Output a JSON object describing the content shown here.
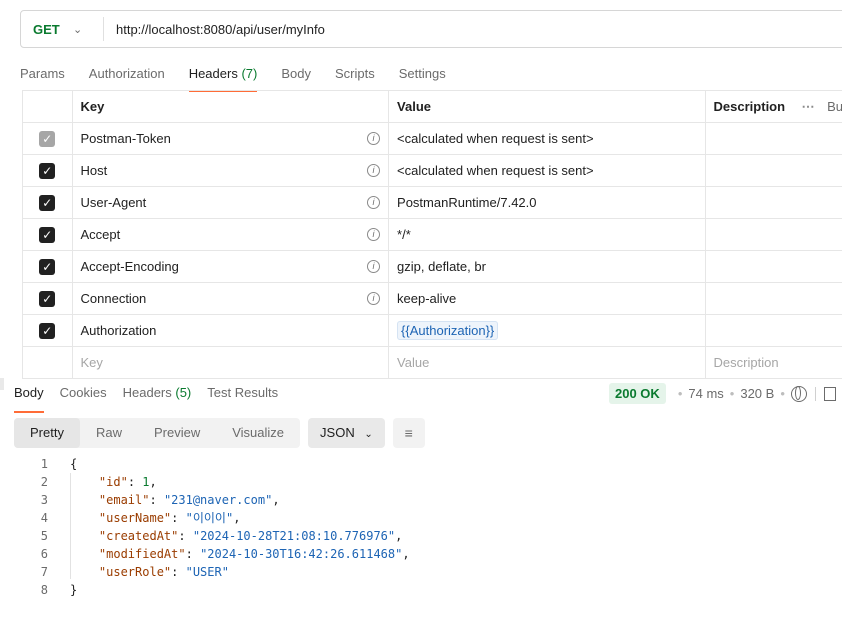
{
  "request": {
    "method": "GET",
    "url": "http://localhost:8080/api/user/myInfo"
  },
  "request_tabs": [
    {
      "label": "Params",
      "count": ""
    },
    {
      "label": "Authorization",
      "count": ""
    },
    {
      "label": "Headers",
      "count": "(7)"
    },
    {
      "label": "Body",
      "count": ""
    },
    {
      "label": "Scripts",
      "count": ""
    },
    {
      "label": "Settings",
      "count": ""
    }
  ],
  "headers_table": {
    "columns": {
      "key": "Key",
      "value": "Value",
      "description": "Description",
      "bulk": "Bu"
    },
    "rows": [
      {
        "key": "Postman-Token",
        "value": "<calculated when request is sent>",
        "checked": true,
        "dimmed": true,
        "info": true,
        "variable": false
      },
      {
        "key": "Host",
        "value": "<calculated when request is sent>",
        "checked": true,
        "dimmed": false,
        "info": true,
        "variable": false
      },
      {
        "key": "User-Agent",
        "value": "PostmanRuntime/7.42.0",
        "checked": true,
        "dimmed": false,
        "info": true,
        "variable": false
      },
      {
        "key": "Accept",
        "value": "*/*",
        "checked": true,
        "dimmed": false,
        "info": true,
        "variable": false
      },
      {
        "key": "Accept-Encoding",
        "value": "gzip, deflate, br",
        "checked": true,
        "dimmed": false,
        "info": true,
        "variable": false
      },
      {
        "key": "Connection",
        "value": "keep-alive",
        "checked": true,
        "dimmed": false,
        "info": true,
        "variable": false
      },
      {
        "key": "Authorization",
        "value": "{{Authorization}}",
        "checked": true,
        "dimmed": false,
        "info": false,
        "variable": true
      }
    ],
    "placeholder": {
      "key": "Key",
      "value": "Value",
      "description": "Description"
    }
  },
  "response_tabs": [
    {
      "label": "Body",
      "count": ""
    },
    {
      "label": "Cookies",
      "count": ""
    },
    {
      "label": "Headers",
      "count": "(5)"
    },
    {
      "label": "Test Results",
      "count": ""
    }
  ],
  "response_status": {
    "status": "200 OK",
    "time": "74 ms",
    "size": "320 B"
  },
  "format_bar": {
    "modes": [
      "Pretty",
      "Raw",
      "Preview",
      "Visualize"
    ],
    "active_mode": "Pretty",
    "language": "JSON"
  },
  "response_body": {
    "lines": [
      {
        "no": "1",
        "parts": [
          {
            "t": "p",
            "v": "{"
          }
        ]
      },
      {
        "no": "2",
        "parts": [
          {
            "t": "p",
            "v": "    "
          },
          {
            "t": "k",
            "v": "\"id\""
          },
          {
            "t": "p",
            "v": ": "
          },
          {
            "t": "n",
            "v": "1"
          },
          {
            "t": "p",
            "v": ","
          }
        ]
      },
      {
        "no": "3",
        "parts": [
          {
            "t": "p",
            "v": "    "
          },
          {
            "t": "k",
            "v": "\"email\""
          },
          {
            "t": "p",
            "v": ": "
          },
          {
            "t": "s",
            "v": "\"231@naver.com\""
          },
          {
            "t": "p",
            "v": ","
          }
        ]
      },
      {
        "no": "4",
        "parts": [
          {
            "t": "p",
            "v": "    "
          },
          {
            "t": "k",
            "v": "\"userName\""
          },
          {
            "t": "p",
            "v": ": "
          },
          {
            "t": "s",
            "v": "\"이이이\""
          },
          {
            "t": "p",
            "v": ","
          }
        ]
      },
      {
        "no": "5",
        "parts": [
          {
            "t": "p",
            "v": "    "
          },
          {
            "t": "k",
            "v": "\"createdAt\""
          },
          {
            "t": "p",
            "v": ": "
          },
          {
            "t": "s",
            "v": "\"2024-10-28T21:08:10.776976\""
          },
          {
            "t": "p",
            "v": ","
          }
        ]
      },
      {
        "no": "6",
        "parts": [
          {
            "t": "p",
            "v": "    "
          },
          {
            "t": "k",
            "v": "\"modifiedAt\""
          },
          {
            "t": "p",
            "v": ": "
          },
          {
            "t": "s",
            "v": "\"2024-10-30T16:42:26.611468\""
          },
          {
            "t": "p",
            "v": ","
          }
        ]
      },
      {
        "no": "7",
        "parts": [
          {
            "t": "p",
            "v": "    "
          },
          {
            "t": "k",
            "v": "\"userRole\""
          },
          {
            "t": "p",
            "v": ": "
          },
          {
            "t": "s",
            "v": "\"USER\""
          }
        ]
      },
      {
        "no": "8",
        "parts": [
          {
            "t": "p",
            "v": "}"
          }
        ]
      }
    ]
  },
  "colors": {
    "accent": "#ff6c37",
    "method": "#0a7a2f",
    "status_ok": "#0a7a2f",
    "json_key": "#9a3c00",
    "json_string": "#1d64b4",
    "json_number": "#0a7a2f"
  }
}
